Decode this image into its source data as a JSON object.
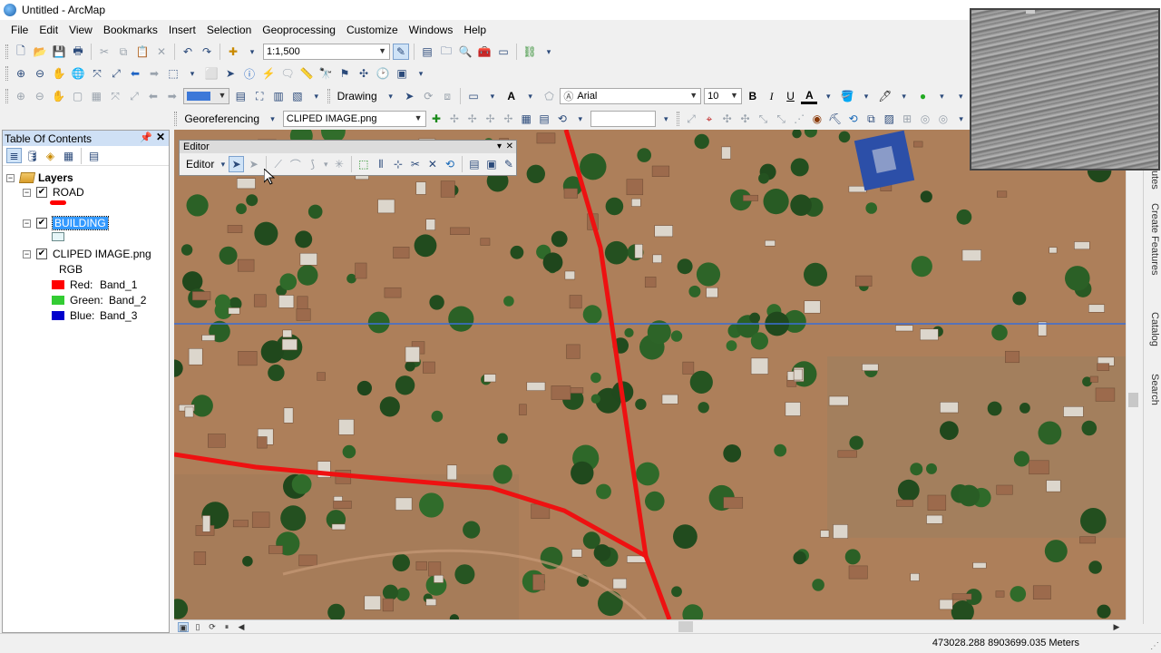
{
  "window": {
    "title": "Untitled - ArcMap"
  },
  "menu": [
    "File",
    "Edit",
    "View",
    "Bookmarks",
    "Insert",
    "Selection",
    "Geoprocessing",
    "Customize",
    "Windows",
    "Help"
  ],
  "toolbar": {
    "scale": "1:1,500",
    "drawing_label": "Drawing",
    "font_name": "Arial",
    "font_size": "10",
    "bold": "B",
    "italic": "I",
    "underline": "U",
    "text_tool": "A",
    "font_color_letter": "A",
    "georeferencing_label": "Georeferencing",
    "georef_layer": "CLIPED IMAGE.png",
    "georef_input": ""
  },
  "toc": {
    "title": "Table Of Contents",
    "root_label": "Layers",
    "layers": [
      {
        "label": "ROAD",
        "checked": true,
        "swatch": "#ff0000"
      },
      {
        "label": "BUILDING",
        "checked": true,
        "swatch": "#e6f6f8",
        "selected": true
      },
      {
        "label": "CLIPED IMAGE.png",
        "checked": true,
        "subtitle": "RGB",
        "bands": [
          {
            "color_label": "Red:",
            "band": "Band_1",
            "color": "#ff0000"
          },
          {
            "color_label": "Green:",
            "band": "Band_2",
            "color": "#33cc33"
          },
          {
            "color_label": "Blue:",
            "band": "Band_3",
            "color": "#0000cc"
          }
        ]
      }
    ]
  },
  "editor": {
    "title": "Editor",
    "menu_label": "Editor"
  },
  "sidetabs": [
    "Create Features",
    "Catalog",
    "Search"
  ],
  "sidetab_partial": "utes",
  "status": {
    "coords": "473028.288  8903699.035 Meters"
  },
  "colors": {
    "road": "#ee1111",
    "selection_line": "#3a6fd8",
    "toc_header": "#cfe0f5"
  }
}
